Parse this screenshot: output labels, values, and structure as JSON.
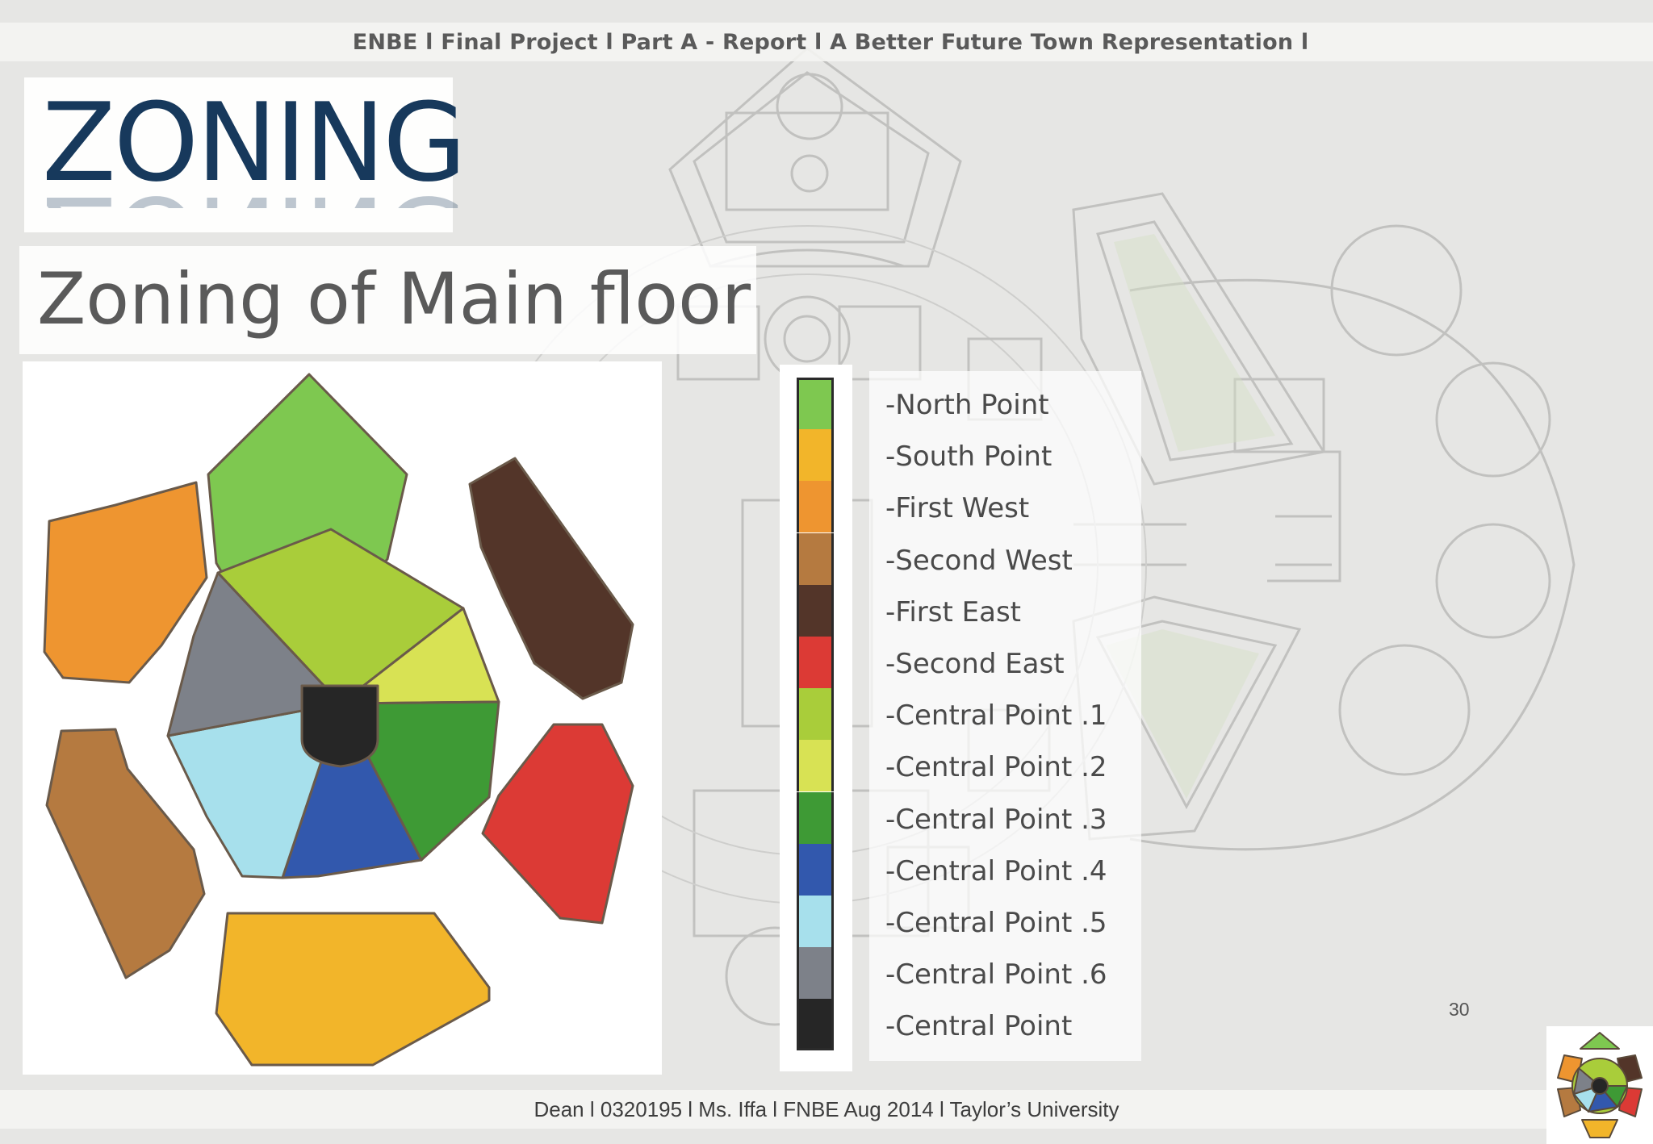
{
  "header": {
    "text": "ENBE l Final Project l Part A - Report l A Better Future Town Representation  l"
  },
  "title": "ZONING",
  "subtitle": "Zoning of Main floor",
  "legend": {
    "items": [
      {
        "label": "-North Point",
        "color": "#7ec850"
      },
      {
        "label": "-South Point",
        "color": "#f2b52a"
      },
      {
        "label": "-First West",
        "color": "#ee9530"
      },
      {
        "label": "-Second West",
        "color": "#b57a40"
      },
      {
        "label": "-First East",
        "color": "#533529"
      },
      {
        "label": "-Second East",
        "color": "#dc3a35"
      },
      {
        "label": "-Central Point .1",
        "color": "#a9cd3a"
      },
      {
        "label": "-Central Point .2",
        "color": "#d8e254"
      },
      {
        "label": "-Central Point .3",
        "color": "#3e9a35"
      },
      {
        "label": "-Central Point .4",
        "color": "#3258ad"
      },
      {
        "label": "-Central Point .5",
        "color": "#a7e0ec"
      },
      {
        "label": "-Central Point .6",
        "color": "#7d8189"
      },
      {
        "label": "-Central Point",
        "color": "#262626"
      }
    ]
  },
  "page_number": "30",
  "footer": {
    "text": "Dean l 0320195 l Ms. Iffa l FNBE Aug 2014 l Taylor’s University"
  }
}
